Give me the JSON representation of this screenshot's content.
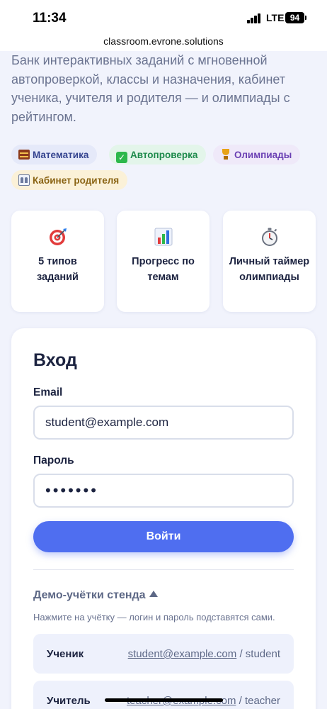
{
  "status_bar": {
    "time": "11:34",
    "network": "LTE",
    "battery": "94"
  },
  "browser": {
    "url": "classroom.evrone.solutions"
  },
  "intro": {
    "text": "Банк интерактивных заданий с мгновенной автопроверкой, классы и назначения, кабинет ученика, учителя и родителя — и олимпиады с рейтингом."
  },
  "tags": [
    {
      "icon": "abacus-icon",
      "label": "Математика"
    },
    {
      "icon": "check-box-icon",
      "label": "Автопроверка"
    },
    {
      "icon": "trophy-icon",
      "label": "Олимпиады"
    },
    {
      "icon": "family-icon",
      "label": "Кабинет родителя"
    }
  ],
  "features": [
    {
      "icon": "target-icon",
      "label": "5 типов заданий"
    },
    {
      "icon": "bar-chart-icon",
      "label": "Прогресс по темам"
    },
    {
      "icon": "stopwatch-icon",
      "label": "Личный таймер олимпиады"
    }
  ],
  "login": {
    "title": "Вход",
    "email_label": "Email",
    "email_value": "student@example.com",
    "password_label": "Пароль",
    "password_value": "•••••••",
    "submit_label": "Войти"
  },
  "demo": {
    "toggle_label": "Демо-учётки стенда",
    "hint": "Нажмите на учётку — логин и пароль подставятся сами.",
    "accounts": [
      {
        "role": "Ученик",
        "email": "student@example.com",
        "password": "/ student"
      },
      {
        "role": "Учитель",
        "email": "teacher@example.com",
        "password": "/ teacher"
      }
    ]
  },
  "colors": {
    "accent": "#4f6ef0",
    "background": "#f1f3fc",
    "text": "#1c2340"
  }
}
